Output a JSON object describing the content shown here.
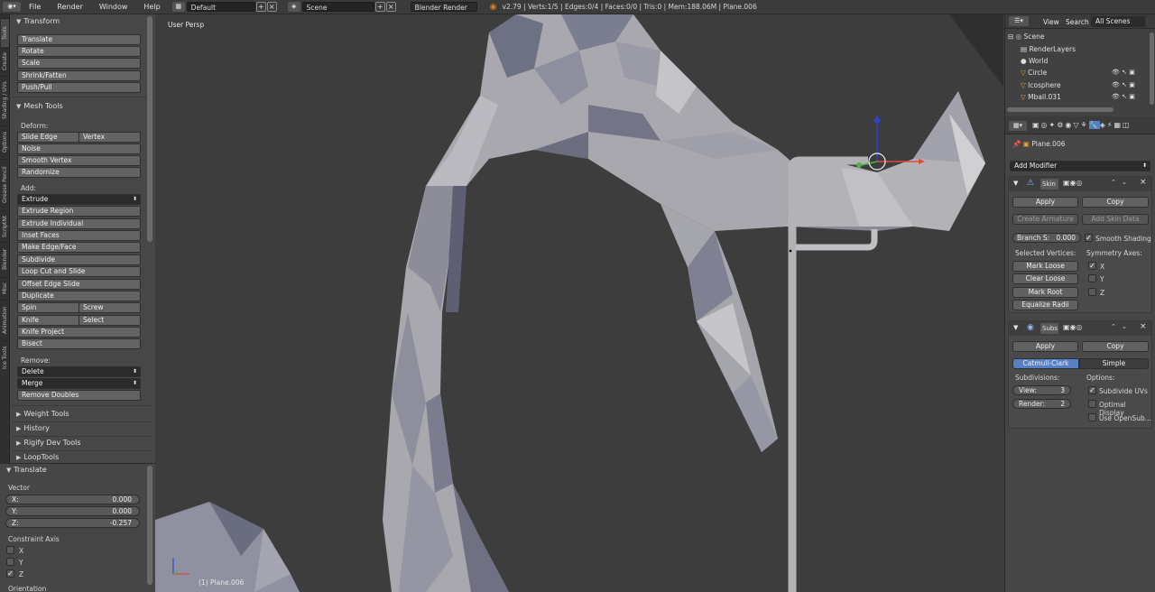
{
  "topbar": {
    "menus": [
      "File",
      "Render",
      "Window",
      "Help"
    ],
    "screen_layout": "Default",
    "scene": "Scene",
    "render_engine": "Blender Render",
    "stats": "v2.79 | Verts:1/5 | Edges:0/4 | Faces:0/0 | Tris:0 | Mem:188.06M | Plane.006"
  },
  "vtabs": [
    "Tools",
    "Create",
    "Shading / UVs",
    "Options",
    "Grease Pencil",
    "ScriptNt",
    "Blender",
    "Misc",
    "Animation",
    "Ice Tools"
  ],
  "shelf": {
    "transform": {
      "title": "Transform",
      "buttons": [
        "Translate",
        "Rotate",
        "Scale",
        "Shrink/Fatten",
        "Push/Pull"
      ]
    },
    "mesh_tools": {
      "title": "Mesh Tools",
      "deform_label": "Deform:",
      "slide_edge": "Slide Edge",
      "vertex": "Vertex",
      "noise": "Noise",
      "smooth_vertex": "Smooth Vertex",
      "randomize": "Randomize",
      "add_label": "Add:",
      "extrude": "Extrude",
      "extrude_region": "Extrude Region",
      "extrude_individual": "Extrude Individual",
      "inset_faces": "Inset Faces",
      "make_edge_face": "Make Edge/Face",
      "subdivide": "Subdivide",
      "loop_cut": "Loop Cut and Slide",
      "offset_edge": "Offset Edge Slide",
      "duplicate": "Duplicate",
      "spin": "Spin",
      "screw": "Screw",
      "knife": "Knife",
      "select": "Select",
      "knife_project": "Knife Project",
      "bisect": "Bisect",
      "remove_label": "Remove:",
      "delete": "Delete",
      "merge": "Merge",
      "remove_doubles": "Remove Doubles"
    },
    "collapsed_panels": [
      "Weight Tools",
      "History",
      "Rigify Dev Tools",
      "LoopTools"
    ]
  },
  "operator": {
    "title": "Translate",
    "vector_label": "Vector",
    "x_label": "X:",
    "x_value": "0.000",
    "y_label": "Y:",
    "y_value": "0.000",
    "z_label": "Z:",
    "z_value": "-0.257",
    "constraint_label": "Constraint Axis",
    "axes": [
      "X",
      "Y",
      "Z"
    ],
    "axes_checked": [
      false,
      false,
      true
    ],
    "orientation_label": "Orientation"
  },
  "viewport": {
    "view_name": "User Persp",
    "object_label": "(1) Plane.006"
  },
  "outliner": {
    "tabs": [
      "View",
      "Search",
      "All Scenes"
    ],
    "items": [
      "Scene",
      "RenderLayers",
      "World",
      "Circle",
      "Icosphere",
      "Mball.031"
    ]
  },
  "properties": {
    "object_name": "Plane.006",
    "add_modifier": "Add Modifier",
    "skin": {
      "name": "Skin",
      "apply": "Apply",
      "copy": "Copy",
      "create_armature": "Create Armature",
      "add_skin_data": "Add Skin Data",
      "branch_label": "Branch S:",
      "branch_value": "0.000",
      "smooth_shading": "Smooth Shading",
      "selected_vertices": "Selected Vertices:",
      "symmetry_axes": "Symmetry Axes:",
      "mark_loose": "Mark Loose",
      "clear_loose": "Clear Loose",
      "mark_root": "Mark Root",
      "equalize_radii": "Equalize Radii",
      "axes": [
        "X",
        "Y",
        "Z"
      ],
      "axes_checked": [
        true,
        false,
        false
      ]
    },
    "subsurf": {
      "name": "Subs",
      "apply": "Apply",
      "copy": "Copy",
      "catmull": "Catmull-Clark",
      "simple": "Simple",
      "subdivisions_label": "Subdivisions:",
      "options_label": "Options:",
      "view_label": "View:",
      "view_value": "3",
      "render_label": "Render:",
      "render_value": "2",
      "subdivide_uvs": "Subdivide UVs",
      "optimal_display": "Optimal Display",
      "use_opensubdiv": "Use OpenSub..."
    }
  },
  "colors": {
    "accent_blue": "#5680c2",
    "mesh_light": "#a9a9ad",
    "mesh_dark": "#6b6d80",
    "x_axis": "#e04b3a",
    "y_axis": "#49b14a",
    "z_axis": "#2f42d8"
  }
}
